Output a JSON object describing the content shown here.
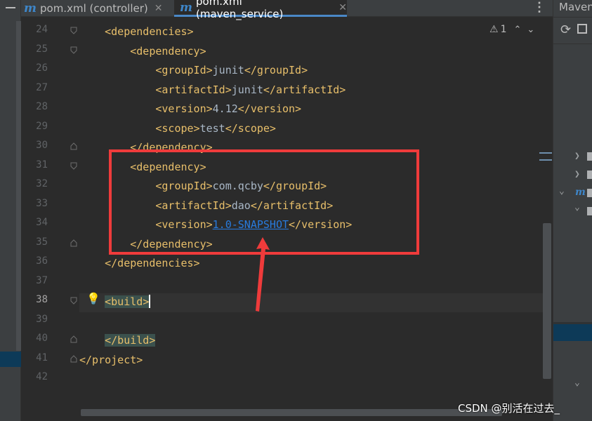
{
  "tabs": [
    {
      "label": "pom.xml (controller)",
      "active": false
    },
    {
      "label": "pom.xml (maven_service)",
      "active": true
    }
  ],
  "tab_icon": "m-icon",
  "close_glyph": "✕",
  "more_glyph": "⋮",
  "right_panel": {
    "title": "Maven"
  },
  "warning": {
    "count": "1",
    "icon": "warning-icon"
  },
  "line_numbers": [
    "24",
    "25",
    "26",
    "27",
    "28",
    "29",
    "30",
    "31",
    "32",
    "33",
    "34",
    "35",
    "36",
    "37",
    "38",
    "39",
    "40",
    "41",
    "42"
  ],
  "current_line": "38",
  "code": {
    "l24": "<dependencies>",
    "l25": "<dependency>",
    "l26": {
      "open": "<groupId>",
      "value": "junit",
      "close": "</groupId>"
    },
    "l27": {
      "open": "<artifactId>",
      "value": "junit",
      "close": "</artifactId>"
    },
    "l28": {
      "open": "<version>",
      "value": "4.12",
      "close": "</version>"
    },
    "l29": {
      "open": "<scope>",
      "value": "test",
      "close": "</scope>"
    },
    "l30": "</dependency>",
    "l31": "<dependency>",
    "l32": {
      "open": "<groupId>",
      "value": "com.qcby",
      "close": "</groupId>"
    },
    "l33": {
      "open": "<artifactId>",
      "value": "dao",
      "close": "</artifactId>"
    },
    "l34": {
      "open": "<version>",
      "value": "1.0-SNAPSHOT",
      "close": "</version>"
    },
    "l35": "</dependency>",
    "l36": "</dependencies>",
    "l38": "<build>",
    "l40": "</build>",
    "l41": "</project>"
  },
  "colors": {
    "tag": "#e8bf6a",
    "text": "#a9b7c6",
    "link": "#287bde",
    "annotation": "#ef3b3b"
  },
  "watermark": "CSDN @别活在过去_"
}
